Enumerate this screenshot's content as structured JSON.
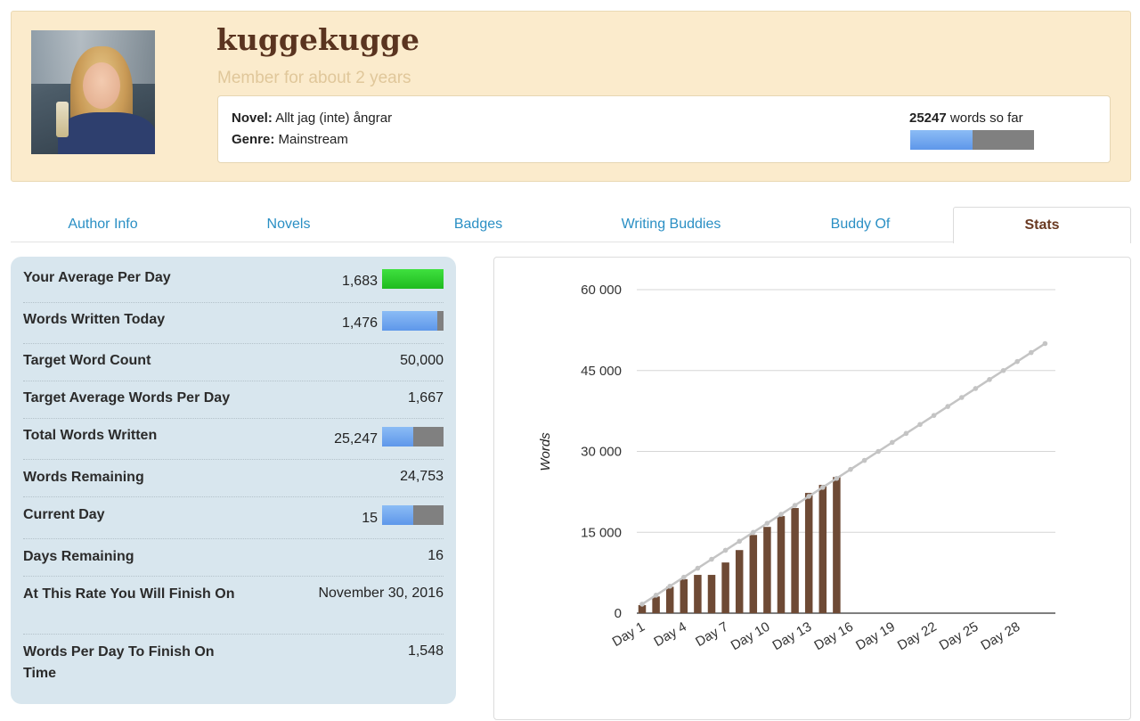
{
  "profile": {
    "username": "kuggekugge",
    "member_since": "Member for about 2 years",
    "novel_label": "Novel:",
    "novel_title": "Allt jag (inte) ångrar",
    "genre_label": "Genre:",
    "genre": "Mainstream",
    "words_count": "25247",
    "words_suffix": "words so far",
    "progress_fraction": 0.505
  },
  "tabs": [
    {
      "label": "Author Info",
      "active": false
    },
    {
      "label": "Novels",
      "active": false
    },
    {
      "label": "Badges",
      "active": false
    },
    {
      "label": "Writing Buddies",
      "active": false
    },
    {
      "label": "Buddy Of",
      "active": false
    },
    {
      "label": "Stats",
      "active": true
    }
  ],
  "stats": [
    {
      "label": "Your Average Per Day",
      "value": "1,683",
      "bar": "green",
      "fraction": 1.0
    },
    {
      "label": "Words Written Today",
      "value": "1,476",
      "bar": "blue",
      "fraction": 0.9
    },
    {
      "label": "Target Word Count",
      "value": "50,000"
    },
    {
      "label": "Target Average Words Per Day",
      "value": "1,667"
    },
    {
      "label": "Total Words Written",
      "value": "25,247",
      "bar": "blue",
      "fraction": 0.505
    },
    {
      "label": "Words Remaining",
      "value": "24,753"
    },
    {
      "label": "Current Day",
      "value": "15",
      "bar": "blue",
      "fraction": 0.5
    },
    {
      "label": "Days Remaining",
      "value": "16"
    },
    {
      "label": "At This Rate You Will Finish On",
      "value": "November 30, 2016"
    },
    {
      "label": "Words Per Day To Finish On Time",
      "value": "1,548"
    }
  ],
  "colors": {
    "bar_color": "#6e4a35",
    "target_line": "#c4c4c4",
    "tab_link": "#2a8fc4",
    "tab_active": "#6a3a22"
  },
  "chart_data": {
    "type": "bar",
    "ylabel": "Words",
    "ylim": [
      0,
      60000
    ],
    "yticks": [
      0,
      15000,
      30000,
      45000,
      60000
    ],
    "ytick_labels": [
      "0",
      "15 000",
      "30 000",
      "45 000",
      "60 000"
    ],
    "x": [
      "Day 1",
      "Day 2",
      "Day 3",
      "Day 4",
      "Day 5",
      "Day 6",
      "Day 7",
      "Day 8",
      "Day 9",
      "Day 10",
      "Day 11",
      "Day 12",
      "Day 13",
      "Day 14",
      "Day 15",
      "Day 16",
      "Day 17",
      "Day 18",
      "Day 19",
      "Day 20",
      "Day 21",
      "Day 22",
      "Day 23",
      "Day 24",
      "Day 25",
      "Day 26",
      "Day 27",
      "Day 28",
      "Day 29",
      "Day 30"
    ],
    "xtick_labels": [
      "Day 1",
      "Day 4",
      "Day 7",
      "Day 10",
      "Day 13",
      "Day 16",
      "Day 19",
      "Day 22",
      "Day 25",
      "Day 28"
    ],
    "series": [
      {
        "values": [
          1500,
          3100,
          4900,
          6300,
          7100,
          7100,
          9400,
          11700,
          14500,
          16000,
          18000,
          19500,
          22300,
          23800,
          25247
        ]
      },
      {
        "values": [
          1667,
          3333,
          5000,
          6667,
          8333,
          10000,
          11667,
          13333,
          15000,
          16667,
          18333,
          20000,
          21667,
          23333,
          25000,
          26667,
          28333,
          30000,
          31667,
          33333,
          35000,
          36667,
          38333,
          40000,
          41667,
          43333,
          45000,
          46667,
          48333,
          50000
        ]
      }
    ]
  }
}
